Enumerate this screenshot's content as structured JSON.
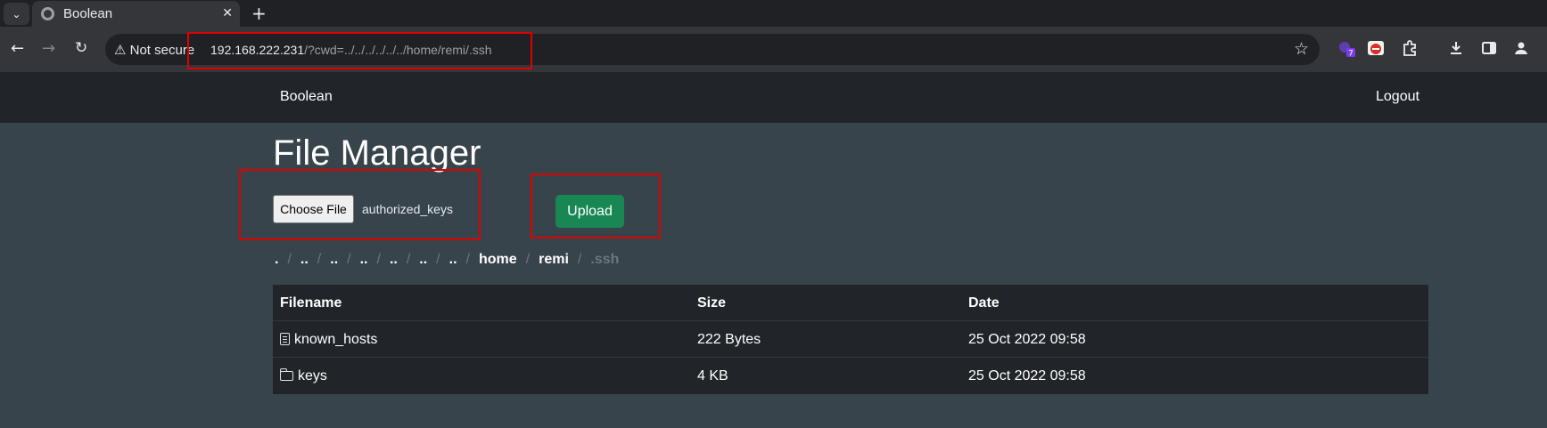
{
  "browser": {
    "tab_title": "Boolean",
    "security_label": "Not secure",
    "url_host": "192.168.222.231",
    "url_rest": "/?cwd=../../../../../../home/remi/.ssh",
    "extension_badge": "7"
  },
  "site": {
    "brand": "Boolean",
    "logout_label": "Logout"
  },
  "main": {
    "title": "File Manager",
    "choose_file_label": "Choose File",
    "chosen_file": "authorized_keys",
    "upload_label": "Upload"
  },
  "breadcrumb": [
    ".",
    "..",
    "..",
    "..",
    "..",
    "..",
    "..",
    "home",
    "remi",
    ".ssh"
  ],
  "table": {
    "headers": [
      "Filename",
      "Size",
      "Date"
    ],
    "rows": [
      {
        "icon": "file-icon",
        "name": "known_hosts",
        "size": "222 Bytes",
        "date": "25 Oct 2022 09:58"
      },
      {
        "icon": "folder-icon",
        "name": "keys",
        "size": "4 KB",
        "date": "25 Oct 2022 09:58"
      }
    ]
  },
  "colors": {
    "page_bg": "#37444c",
    "upload_green": "#198754",
    "highlight_red": "#e00000"
  }
}
